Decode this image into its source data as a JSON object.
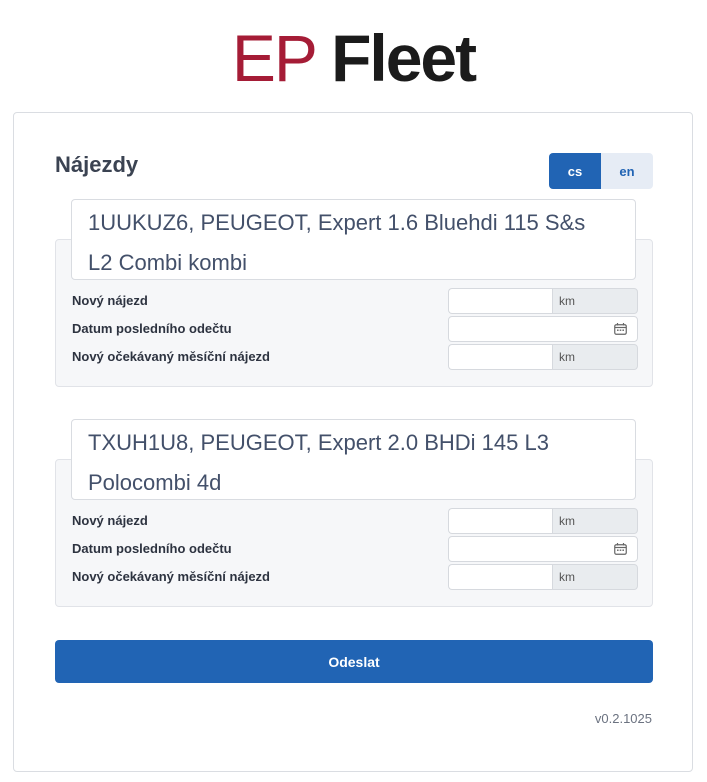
{
  "logo": {
    "part1": "EP",
    "part2": "Fleet"
  },
  "page": {
    "title": "Nájezdy"
  },
  "language": {
    "options": [
      "cs",
      "en"
    ],
    "selected": "cs"
  },
  "vehicles": [
    {
      "name_line1": "1UUKUZ6, PEUGEOT, Expert 1.6 Bluehdi 115 S&s",
      "name_line2": "L2 Combi kombi",
      "new_mileage_label": "Nový nájezd",
      "new_mileage_value": "",
      "new_mileage_unit": "km",
      "last_reading_date_label": "Datum posledního odečtu",
      "last_reading_date_value": "",
      "expected_monthly_label": "Nový očekávaný měsíční nájezd",
      "expected_monthly_value": "",
      "expected_monthly_unit": "km"
    },
    {
      "name_line1": "TXUH1U8, PEUGEOT, Expert 2.0 BHDi 145 L3",
      "name_line2": "Polocombi 4d",
      "new_mileage_label": "Nový nájezd",
      "new_mileage_value": "",
      "new_mileage_unit": "km",
      "last_reading_date_label": "Datum posledního odečtu",
      "last_reading_date_value": "",
      "expected_monthly_label": "Nový očekávaný měsíční nájezd",
      "expected_monthly_value": "",
      "expected_monthly_unit": "km"
    }
  ],
  "submit": {
    "label": "Odeslat"
  },
  "version": "v0.2.1025",
  "colors": {
    "brand_red": "#a51c36",
    "primary": "#2164b4"
  },
  "icons": {
    "date": "calendar-icon"
  }
}
